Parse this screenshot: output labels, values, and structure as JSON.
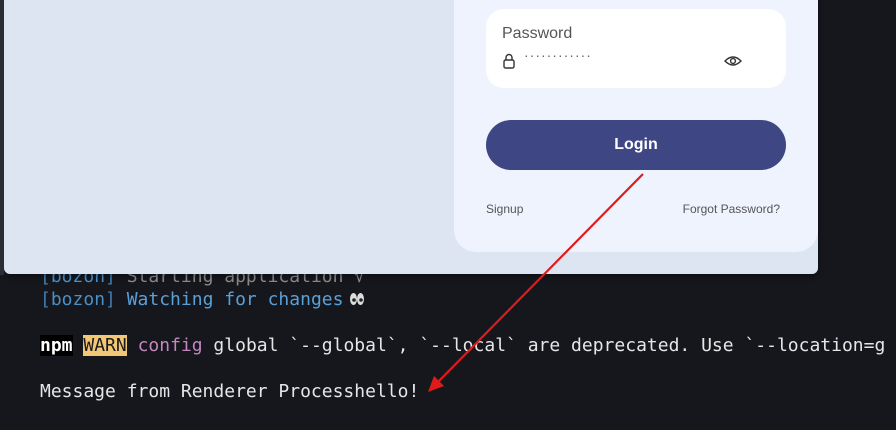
{
  "terminal": {
    "line1": {
      "tag_open": "[",
      "tag": "bozon",
      "tag_close": "]",
      "text": " Starting application √"
    },
    "line2": {
      "tag_open": "[",
      "tag": "bozon",
      "tag_close": "]",
      "text": " Watching for changes"
    },
    "line3": {
      "npm": "npm",
      "warn": "WARN",
      "config": "config",
      "text": " global `--global`, `--local` are deprecated. Use `--location=g"
    },
    "line4": {
      "text": "Message from Renderer Processhello!"
    }
  },
  "app": {
    "password_label": "Password",
    "password_value": "············",
    "login_label": "Login",
    "signup_label": "Signup",
    "forgot_label": "Forgot Password?"
  },
  "colors": {
    "accent": "#3e4784",
    "annotation_arrow": "#e01b1b"
  },
  "icons": [
    "lock-icon",
    "eye-icon",
    "eyes-icon"
  ]
}
